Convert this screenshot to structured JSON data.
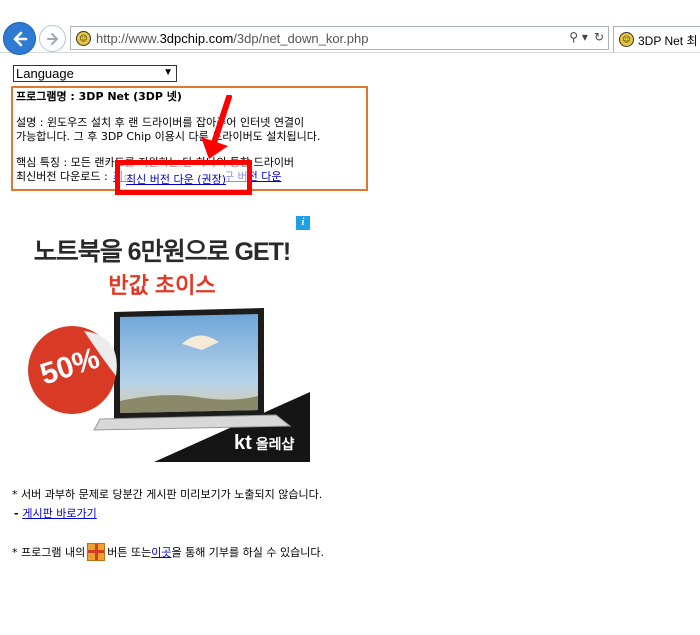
{
  "browser": {
    "url_prefix": "http://www.",
    "url_host": "3dpchip.com",
    "url_path": "/3dp/net_down_kor.php",
    "search_glyph": "⚲ ▾",
    "refresh_glyph": "↻",
    "tab_title": "3DP Net 최"
  },
  "page": {
    "language_select": {
      "selected": "Language",
      "options": [
        "Language"
      ]
    },
    "info": {
      "title": "프로그램명 : 3DP Net (3DP 넷)",
      "desc_line1": "설명 : 윈도우즈 설치 후 랜 드라이버를 잡아주어 인터넷 연결이",
      "desc_line2": "가능합니다. 그 후 3DP Chip 이용시 다른 드라이버도 설치됩니다.",
      "feature_line": "핵심 특징 : 모든 랜카드를 지원하는 단 하나의 통합 드라이버",
      "download_prefix": "최신버전 다운로드 : ",
      "latest_download_link": "최신 버전 다운 (권장)",
      "old_download_link": "구 버전 다운"
    },
    "ad": {
      "headline": "노트북을 6만원으로 GET!",
      "subheadline": "반값 초이스",
      "badge": "50%",
      "brand_kt": "kt",
      "brand_name": "올레샵",
      "info_icon": "i"
    },
    "notes": {
      "server_notice": "* 서버 과부하 문제로 당분간 게시판 미리보기가 노출되지 않습니다.",
      "board_link_prefix": "- ",
      "board_link": "게시판 바로가기",
      "donate_prefix": "* 프로그램 내의 ",
      "donate_middle": " 버튼 또는 ",
      "donate_link": "이곳",
      "donate_suffix": "을 통해 기부를 하실 수 있습니다."
    }
  },
  "colors": {
    "box_border": "#e0782f",
    "highlight": "#ff0000",
    "link": "#0000cc",
    "ad_red": "#e03a26"
  }
}
